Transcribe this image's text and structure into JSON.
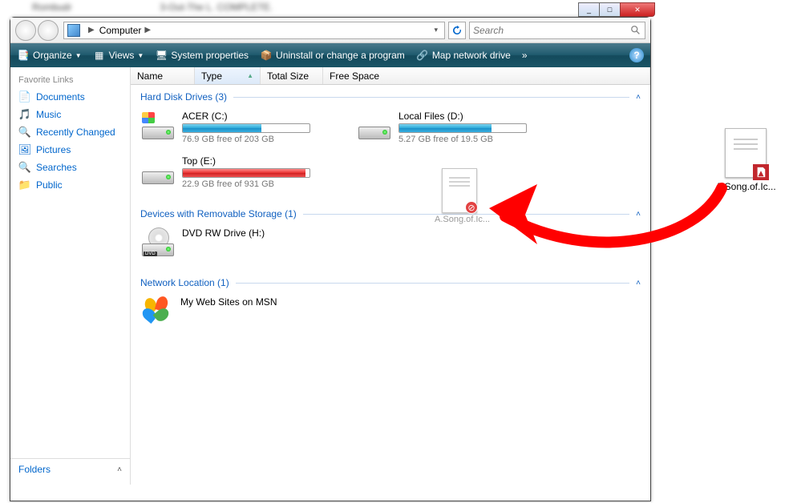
{
  "window_controls": {
    "min": "_",
    "max": "□",
    "close": "✕"
  },
  "address": {
    "location": "Computer",
    "arrow": "▶"
  },
  "search": {
    "placeholder": "Search"
  },
  "toolbar": {
    "organize": "Organize",
    "views": "Views",
    "sysprops": "System properties",
    "uninstall": "Uninstall or change a program",
    "mapdrive": "Map network drive",
    "more": "»"
  },
  "sidebar": {
    "header": "Favorite Links",
    "items": [
      {
        "label": "Documents",
        "icon": "📄"
      },
      {
        "label": "Music",
        "icon": "🎵"
      },
      {
        "label": "Recently Changed",
        "icon": "🔍"
      },
      {
        "label": "Pictures",
        "icon": "🖼"
      },
      {
        "label": "Searches",
        "icon": "🔍"
      },
      {
        "label": "Public",
        "icon": "📁"
      }
    ],
    "folders": "Folders"
  },
  "columns": {
    "name": "Name",
    "type": "Type",
    "total": "Total Size",
    "free": "Free Space"
  },
  "groups": {
    "hdd": {
      "title": "Hard Disk Drives (3)"
    },
    "removable": {
      "title": "Devices with Removable Storage (1)"
    },
    "network": {
      "title": "Network Location (1)"
    }
  },
  "drives": {
    "c": {
      "name": "ACER (C:)",
      "free": "76.9 GB free of 203 GB",
      "fill_pct": 62,
      "color": "blue",
      "primary": true
    },
    "d": {
      "name": "Local Files (D:)",
      "free": "5.27 GB free of 19.5 GB",
      "fill_pct": 73,
      "color": "blue",
      "primary": false
    },
    "e": {
      "name": "Top (E:)",
      "free": "22.9 GB free of 931 GB",
      "fill_pct": 97,
      "color": "red",
      "primary": false
    }
  },
  "dvd": {
    "name": "DVD RW Drive (H:)"
  },
  "msn": {
    "name": "My Web Sites on MSN"
  },
  "drag_ghost": {
    "label": "A.Song.of.Ic..."
  },
  "desktop_file": {
    "label": "A.Song.of.Ic..."
  },
  "annotation": {
    "arrow_color": "#ff0000"
  }
}
